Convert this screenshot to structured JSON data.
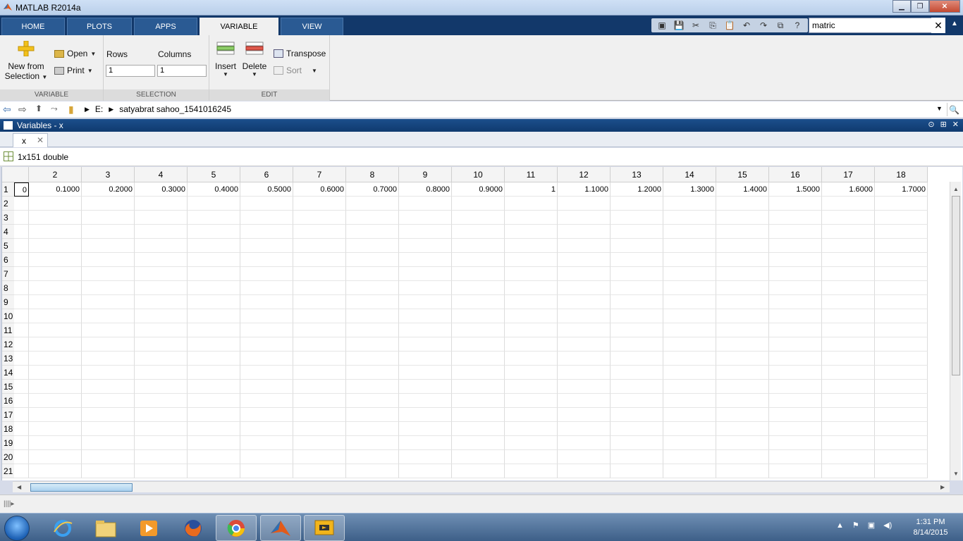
{
  "window": {
    "title": "MATLAB R2014a"
  },
  "tabs": [
    {
      "label": "HOME",
      "active": false
    },
    {
      "label": "PLOTS",
      "active": false
    },
    {
      "label": "APPS",
      "active": false
    },
    {
      "label": "VARIABLE",
      "active": true
    },
    {
      "label": "VIEW",
      "active": false
    }
  ],
  "search": {
    "value": "matric"
  },
  "ribbon": {
    "variable_group": {
      "label": "VARIABLE",
      "new_from_selection_line1": "New from",
      "new_from_selection_line2": "Selection",
      "open": "Open",
      "print": "Print"
    },
    "selection_group": {
      "label": "SELECTION",
      "rows_label": "Rows",
      "columns_label": "Columns",
      "rows_value": "1",
      "columns_value": "1"
    },
    "edit_group": {
      "label": "EDIT",
      "insert": "Insert",
      "delete": "Delete",
      "transpose": "Transpose",
      "sort": "Sort"
    }
  },
  "address": {
    "drive": "E:",
    "folder": "satyabrat sahoo_1541016245"
  },
  "panel": {
    "title": "Variables - x",
    "doc_tab": "x",
    "info": "1x151 double"
  },
  "grid": {
    "col_headers": [
      "2",
      "3",
      "4",
      "5",
      "6",
      "7",
      "8",
      "9",
      "10",
      "11",
      "12",
      "13",
      "14",
      "15",
      "16",
      "17",
      "18"
    ],
    "row_headers": [
      "1",
      "2",
      "3",
      "4",
      "5",
      "6",
      "7",
      "8",
      "9",
      "10",
      "11",
      "12",
      "13",
      "14",
      "15",
      "16",
      "17",
      "18",
      "19",
      "20",
      "21"
    ],
    "row1_values": [
      "0",
      "0.1000",
      "0.2000",
      "0.3000",
      "0.4000",
      "0.5000",
      "0.6000",
      "0.7000",
      "0.8000",
      "0.9000",
      "1",
      "1.1000",
      "1.2000",
      "1.3000",
      "1.4000",
      "1.5000",
      "1.6000",
      "1.7000"
    ]
  },
  "taskbar": {
    "apps": [
      "internet-explorer",
      "file-explorer",
      "media-player",
      "firefox",
      "chrome",
      "matlab",
      "presentation-app"
    ],
    "time": "1:31 PM",
    "date": "8/14/2015"
  }
}
